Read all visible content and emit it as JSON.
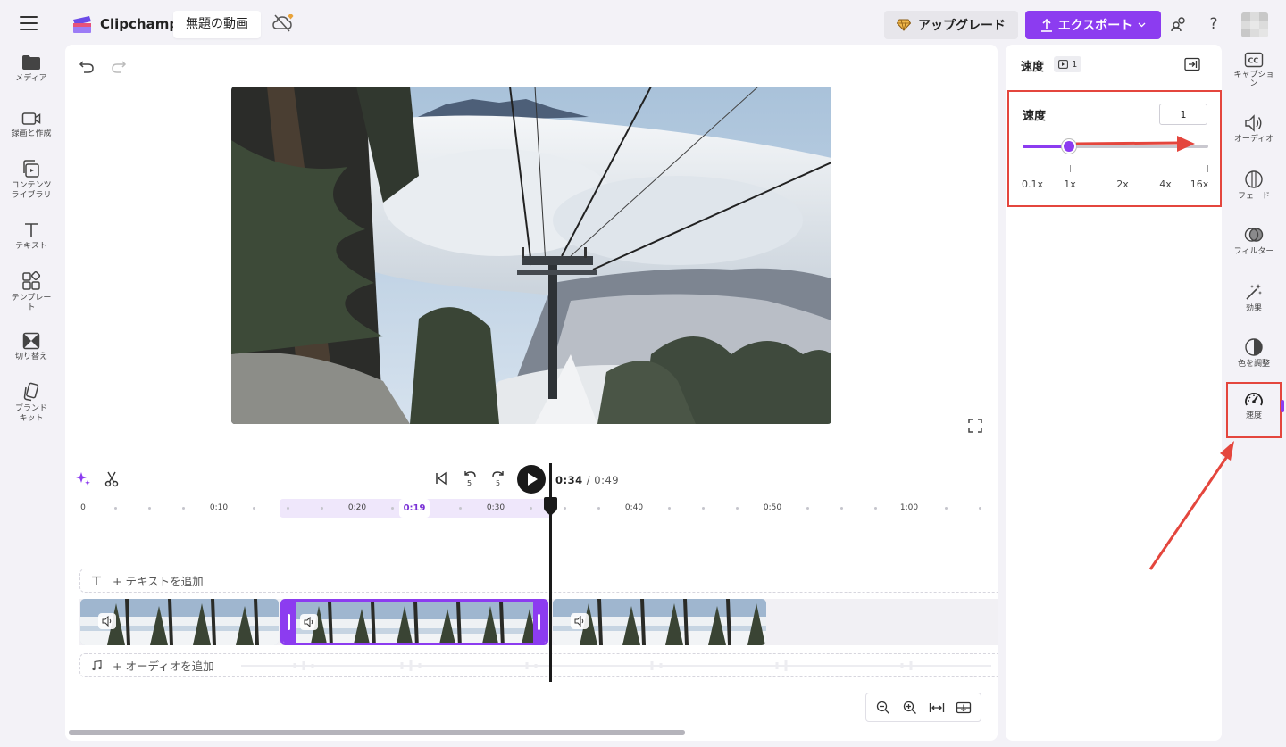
{
  "app": {
    "name": "Clipchamp",
    "project_title": "無題の動画"
  },
  "header": {
    "upgrade_label": "アップグレード",
    "export_label": "エクスポート"
  },
  "left_nav": [
    {
      "id": "media",
      "label": "メディア",
      "icon": "folder-icon"
    },
    {
      "id": "record",
      "label": "録画と作成",
      "icon": "camera-icon"
    },
    {
      "id": "content",
      "label": "コンテンツ\nライブラリ",
      "icon": "library-icon"
    },
    {
      "id": "text",
      "label": "テキスト",
      "icon": "text-icon"
    },
    {
      "id": "templates",
      "label": "テンプレー\nト",
      "icon": "templates-icon"
    },
    {
      "id": "transitions",
      "label": "切り替え",
      "icon": "transitions-icon"
    },
    {
      "id": "brand",
      "label": "ブランド\nキット",
      "icon": "brand-kit-icon"
    }
  ],
  "playback": {
    "current": "0:34",
    "total": "/ 0:49"
  },
  "ruler": {
    "labels": [
      "0",
      "0:10",
      "0:20",
      "0:30",
      "0:40",
      "0:50",
      "1:00"
    ],
    "current_badge": "0:19"
  },
  "tracks": {
    "text_add": "+ テキストを追加",
    "audio_add": "+ オーディオを追加"
  },
  "speed_panel": {
    "header_title": "速度",
    "clip_count": "1",
    "label": "速度",
    "value": "1",
    "slider_fraction": 0.25,
    "ticks": [
      "0.1x",
      "1x",
      "2x",
      "4x",
      "16x"
    ]
  },
  "right_nav": [
    {
      "id": "captions",
      "label": "キャプショ\nン",
      "icon": "captions-icon"
    },
    {
      "id": "audio",
      "label": "オーディオ",
      "icon": "speaker-icon"
    },
    {
      "id": "fade",
      "label": "フェード",
      "icon": "fade-icon"
    },
    {
      "id": "filters",
      "label": "フィルター",
      "icon": "filter-icon"
    },
    {
      "id": "effects",
      "label": "効果",
      "icon": "magic-wand-icon"
    },
    {
      "id": "color",
      "label": "色を調整",
      "icon": "contrast-icon"
    },
    {
      "id": "speed",
      "label": "速度",
      "icon": "speedometer-icon"
    }
  ],
  "colors": {
    "accent": "#8c3cf0",
    "annotation": "#e4463d"
  }
}
